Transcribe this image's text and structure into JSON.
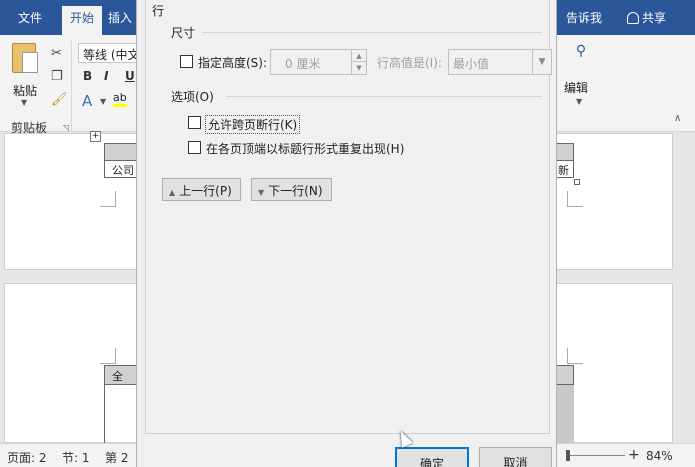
{
  "ribbon": {
    "tabs": [
      "文件",
      "开始",
      "插入"
    ],
    "tell_me": "告诉我",
    "share": "共享",
    "clipboard": {
      "paste": "粘贴",
      "group_label": "剪贴板"
    },
    "font": {
      "font_name": "等线 (中文",
      "bold": "B",
      "italic": "I",
      "underline": "U",
      "font_color": "A",
      "highlight": "ab"
    },
    "editing": {
      "label": "编辑"
    }
  },
  "document": {
    "page1_cell": "公司",
    "page1_right_fragment": "新",
    "page2_cell": "全"
  },
  "statusbar": {
    "page": "页面: 2",
    "section": "节: 1",
    "page_count": "第 2",
    "zoom": "84%"
  },
  "dialog": {
    "tab_label": "行",
    "size_section": "尺寸",
    "specify_height_label": "指定高度(S):",
    "height_value": "0 厘米",
    "row_height_is_label": "行高值是(I):",
    "row_height_value": "最小值",
    "options_section": "选项(O)",
    "allow_break_label": "允许跨页断行(K)",
    "repeat_header_label": "在各页顶端以标题行形式重复出现(H)",
    "prev_row": "上一行(P)",
    "next_row": "下一行(N)",
    "ok": "确定",
    "cancel": "取消",
    "specify_height_checked": false,
    "allow_break_checked": false,
    "repeat_header_checked": false
  }
}
